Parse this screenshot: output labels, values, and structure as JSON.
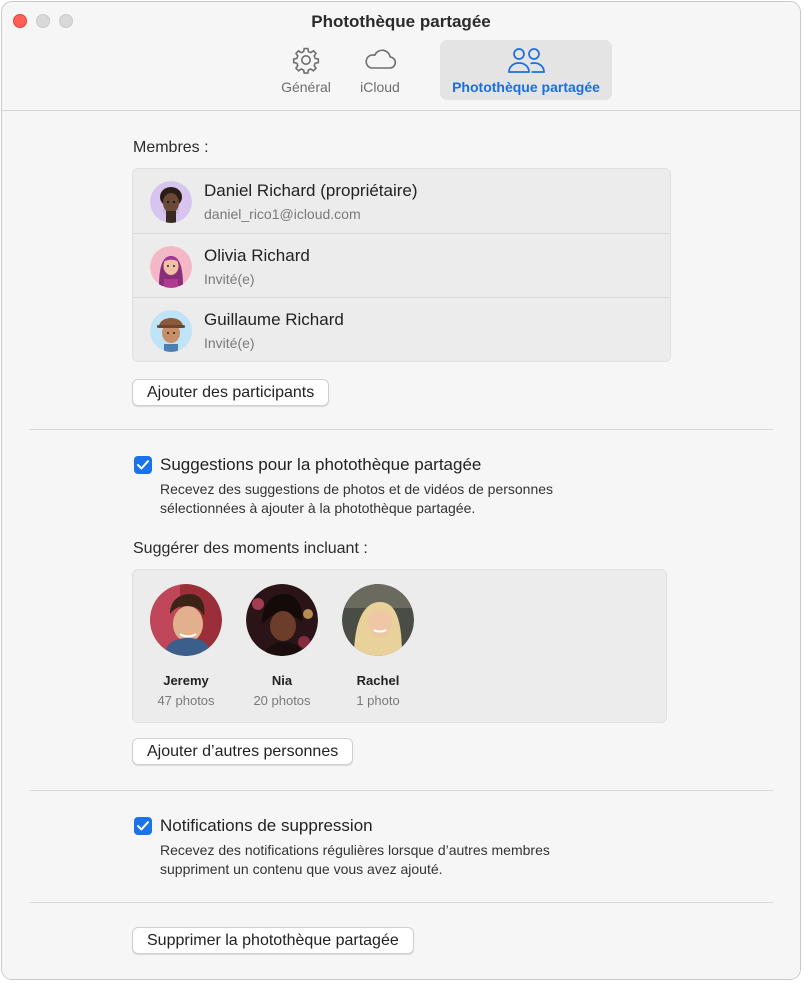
{
  "window": {
    "title": "Photothèque partagée"
  },
  "tabs": [
    {
      "label": "Général",
      "icon": "gear-icon"
    },
    {
      "label": "iCloud",
      "icon": "cloud-icon"
    },
    {
      "label": "Photothèque partagée",
      "icon": "people-icon"
    }
  ],
  "members": {
    "label": "Membres :",
    "list": [
      {
        "name": "Daniel Richard (propriétaire)",
        "detail": "daniel_rico1@icloud.com"
      },
      {
        "name": "Olivia Richard",
        "detail": "Invité(e)"
      },
      {
        "name": "Guillaume Richard",
        "detail": "Invité(e)"
      }
    ],
    "add_button": "Ajouter des participants"
  },
  "suggestions": {
    "checked": true,
    "title": "Suggestions pour la photothèque partagée",
    "description": "Recevez des suggestions de photos et de vidéos de personnes sélectionnées à ajouter à la photothèque partagée."
  },
  "moments": {
    "label": "Suggérer des moments incluant :",
    "people": [
      {
        "name": "Jeremy",
        "count": "47 photos"
      },
      {
        "name": "Nia",
        "count": "20 photos"
      },
      {
        "name": "Rachel",
        "count": "1 photo"
      }
    ],
    "add_button": "Ajouter d’autres personnes"
  },
  "deletion": {
    "checked": true,
    "title": "Notifications de suppression",
    "description": "Recevez des notifications régulières lorsque d’autres membres suppriment un contenu que vous avez ajouté."
  },
  "delete_button": "Supprimer la photothèque partagée",
  "colors": {
    "accent": "#1a73e8",
    "active_tab_text": "#1a6fe0",
    "close_light": "#fe5f57"
  }
}
